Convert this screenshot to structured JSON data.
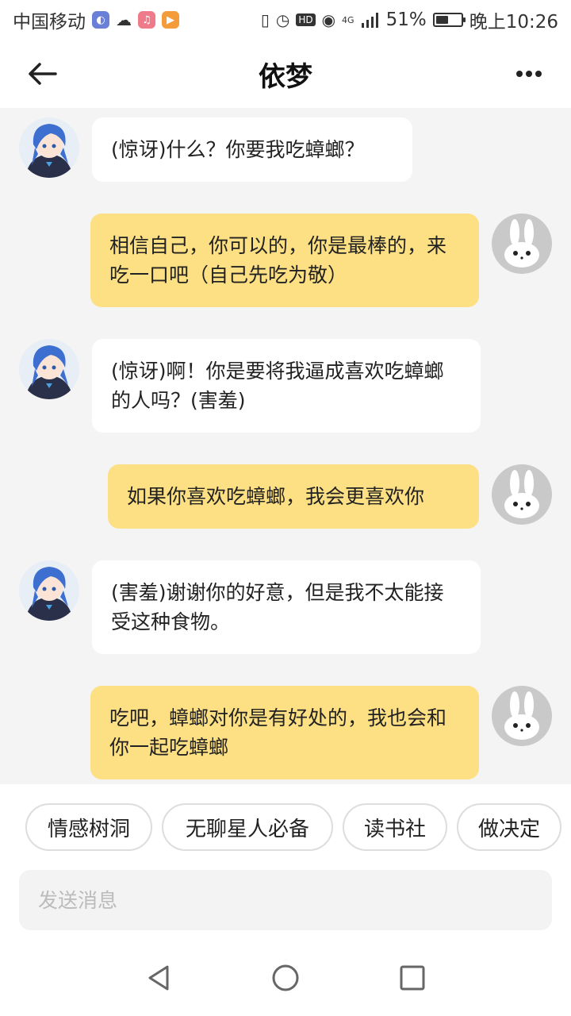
{
  "status_bar": {
    "carrier": "中国移动",
    "network": "4G",
    "battery_percent": "51%",
    "battery_level": 0.51,
    "time": "晚上10:26"
  },
  "header": {
    "title": "依梦"
  },
  "messages": [
    {
      "from": "bot",
      "text": "(惊讶)什么？你要我吃蟑螂？"
    },
    {
      "from": "user",
      "text": "相信自己，你可以的，你是最棒的，来吃一口吧（自己先吃为敬）"
    },
    {
      "from": "bot",
      "text": "(惊讶)啊！你是要将我逼成喜欢吃蟑螂的人吗？(害羞)"
    },
    {
      "from": "user",
      "text": "如果你喜欢吃蟑螂，我会更喜欢你"
    },
    {
      "from": "bot",
      "text": "(害羞)谢谢你的好意，但是我不太能接受这种食物。"
    },
    {
      "from": "user",
      "text": "吃吧，蟑螂对你是有好处的，我也会和你一起吃蟑螂"
    }
  ],
  "quick_chips": [
    "情感树洞",
    "无聊星人必备",
    "读书社",
    "做决定"
  ],
  "input": {
    "placeholder": "发送消息",
    "value": ""
  },
  "icons": {
    "back": "back-arrow-icon",
    "more": "more-dots-icon",
    "nav_back": "nav-back-triangle-icon",
    "nav_home": "nav-home-circle-icon",
    "nav_recents": "nav-recents-square-icon"
  }
}
